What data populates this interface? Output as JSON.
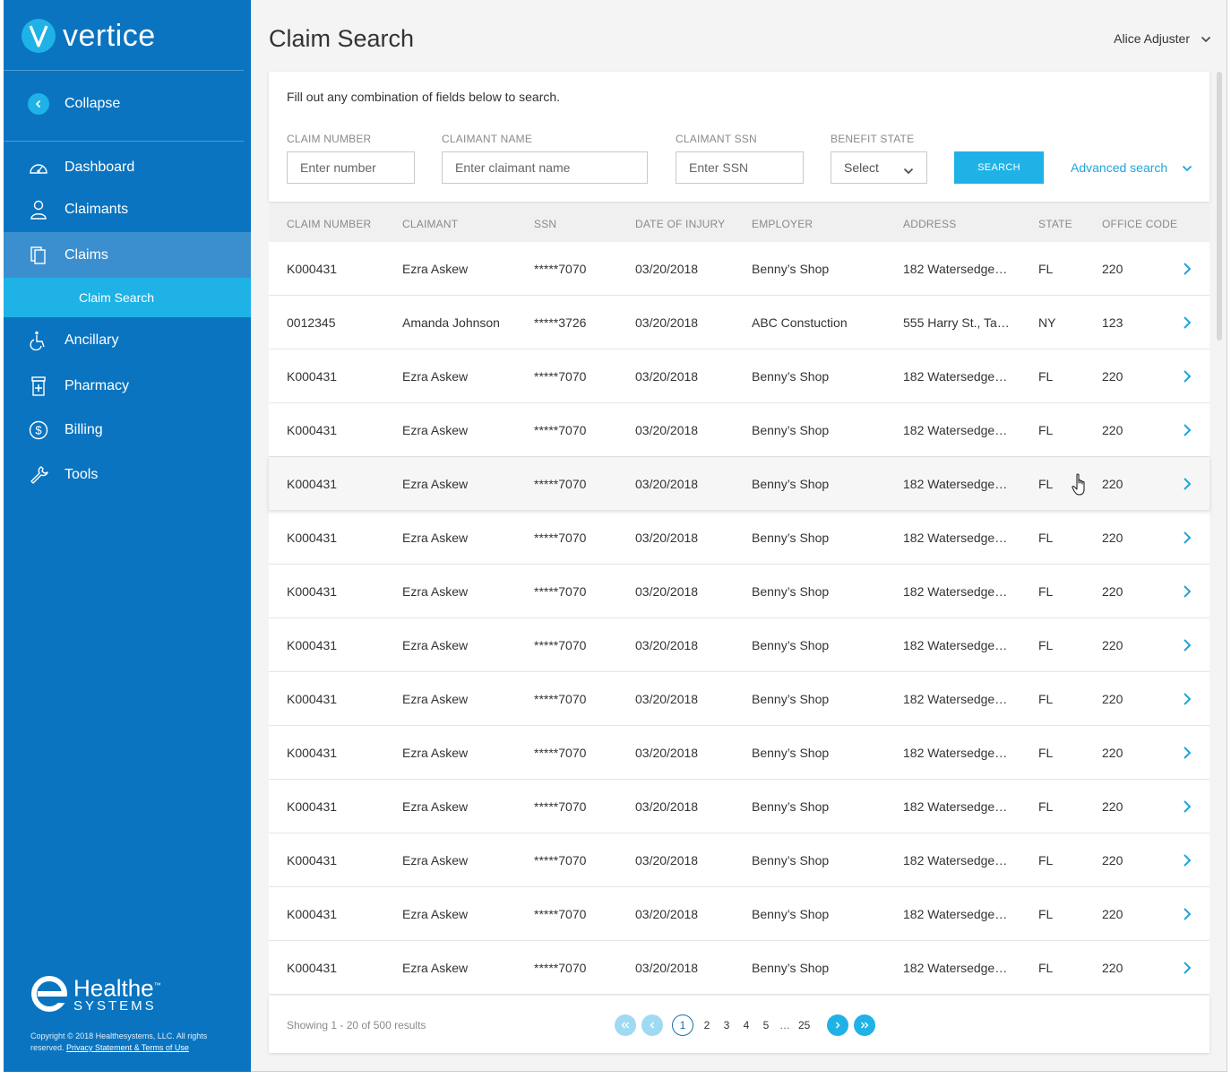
{
  "brand": {
    "name": "vertice",
    "mark_letter": "V",
    "primary": "#0a74c0",
    "accent": "#1fb2e6"
  },
  "sidebar": {
    "collapse_label": "Collapse",
    "items": [
      {
        "label": "Dashboard",
        "icon": "dashboard-gauge-icon"
      },
      {
        "label": "Claimants",
        "icon": "person-icon"
      },
      {
        "label": "Claims",
        "icon": "documents-icon",
        "active": true
      },
      {
        "label": "Ancillary",
        "icon": "wheelchair-icon"
      },
      {
        "label": "Pharmacy",
        "icon": "pill-bottle-icon"
      },
      {
        "label": "Billing",
        "icon": "dollar-circle-icon"
      },
      {
        "label": "Tools",
        "icon": "wrench-icon"
      }
    ],
    "sub_item": "Claim Search",
    "footer_logo": {
      "line1": "Healthe",
      "tm": "™",
      "line2": "SYSTEMS"
    },
    "legal": {
      "text": "Copyright © 2018 Healthesystems, LLC. All rights reserved.",
      "link": "Privacy Statement & Terms of Use"
    }
  },
  "header": {
    "title": "Claim Search",
    "user": "Alice Adjuster"
  },
  "search": {
    "hint": "Fill out any combination of fields below to search.",
    "claim_number": {
      "label": "CLAIM NUMBER",
      "placeholder": "Enter number"
    },
    "claimant_name": {
      "label": "CLAIMANT NAME",
      "placeholder": "Enter claimant name"
    },
    "claimant_ssn": {
      "label": "CLAIMANT SSN",
      "placeholder": "Enter SSN"
    },
    "benefit_state": {
      "label": "BENEFIT STATE",
      "value": "Select"
    },
    "button": "SEARCH",
    "advanced": "Advanced search"
  },
  "table": {
    "columns": [
      "CLAIM NUMBER",
      "CLAIMANT",
      "SSN",
      "DATE OF INJURY",
      "EMPLOYER",
      "ADDRESS",
      "STATE",
      "OFFICE CODE"
    ],
    "rows": [
      [
        "K000431",
        "Ezra Askew",
        "*****7070",
        "03/20/2018",
        "Benny’s Shop",
        "182 Watersedge…",
        "FL",
        "220"
      ],
      [
        "0012345",
        "Amanda Johnson",
        "*****3726",
        "03/20/2018",
        "ABC Constuction",
        "555 Harry St., Ta…",
        "NY",
        "123"
      ],
      [
        "K000431",
        "Ezra Askew",
        "*****7070",
        "03/20/2018",
        "Benny’s Shop",
        "182 Watersedge…",
        "FL",
        "220"
      ],
      [
        "K000431",
        "Ezra Askew",
        "*****7070",
        "03/20/2018",
        "Benny’s Shop",
        "182 Watersedge…",
        "FL",
        "220"
      ],
      [
        "K000431",
        "Ezra Askew",
        "*****7070",
        "03/20/2018",
        "Benny’s Shop",
        "182 Watersedge…",
        "FL",
        "220"
      ],
      [
        "K000431",
        "Ezra Askew",
        "*****7070",
        "03/20/2018",
        "Benny’s Shop",
        "182 Watersedge…",
        "FL",
        "220"
      ],
      [
        "K000431",
        "Ezra Askew",
        "*****7070",
        "03/20/2018",
        "Benny’s Shop",
        "182 Watersedge…",
        "FL",
        "220"
      ],
      [
        "K000431",
        "Ezra Askew",
        "*****7070",
        "03/20/2018",
        "Benny’s Shop",
        "182 Watersedge…",
        "FL",
        "220"
      ],
      [
        "K000431",
        "Ezra Askew",
        "*****7070",
        "03/20/2018",
        "Benny’s Shop",
        "182 Watersedge…",
        "FL",
        "220"
      ],
      [
        "K000431",
        "Ezra Askew",
        "*****7070",
        "03/20/2018",
        "Benny’s Shop",
        "182 Watersedge…",
        "FL",
        "220"
      ],
      [
        "K000431",
        "Ezra Askew",
        "*****7070",
        "03/20/2018",
        "Benny’s Shop",
        "182 Watersedge…",
        "FL",
        "220"
      ],
      [
        "K000431",
        "Ezra Askew",
        "*****7070",
        "03/20/2018",
        "Benny’s Shop",
        "182 Watersedge…",
        "FL",
        "220"
      ],
      [
        "K000431",
        "Ezra Askew",
        "*****7070",
        "03/20/2018",
        "Benny’s Shop",
        "182 Watersedge…",
        "FL",
        "220"
      ],
      [
        "K000431",
        "Ezra Askew",
        "*****7070",
        "03/20/2018",
        "Benny’s Shop",
        "182 Watersedge…",
        "FL",
        "220"
      ]
    ],
    "hovered_row": 4
  },
  "pagination": {
    "showing": "Showing 1 - 20 of 500 results",
    "pages": [
      "1",
      "2",
      "3",
      "4",
      "5"
    ],
    "current": "1",
    "ellipsis": "…",
    "last": "25"
  }
}
